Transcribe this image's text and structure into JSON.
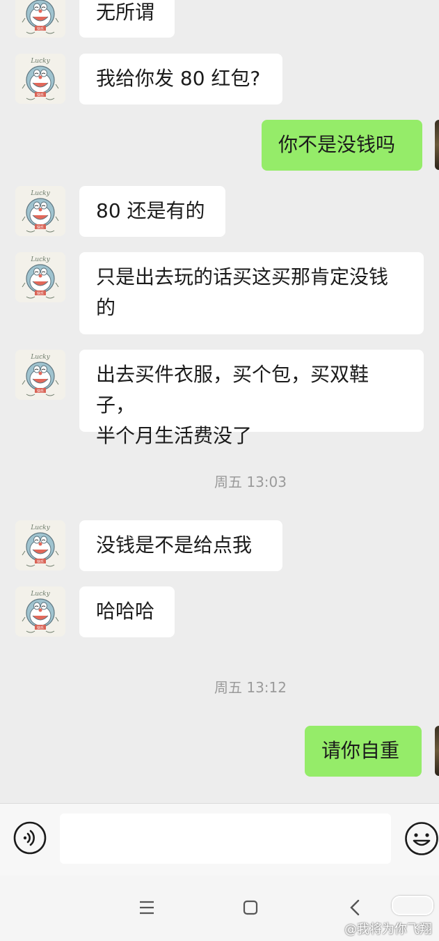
{
  "messages": [
    {
      "side": "left",
      "text": "无所谓"
    },
    {
      "side": "left",
      "text": "我给你发 80 红包?"
    },
    {
      "side": "right",
      "text": "你不是没钱吗"
    },
    {
      "side": "left",
      "text": "80 还是有的"
    },
    {
      "side": "left",
      "text": "只是出去玩的话买这买那肯定没钱\n的"
    },
    {
      "side": "left",
      "text": "出去买件衣服，买个包，买双鞋子，\n半个月生活费没了"
    },
    {
      "timestamp": "周五 13:03"
    },
    {
      "side": "left",
      "text": "没钱是不是给点我"
    },
    {
      "side": "left",
      "text": "哈哈哈"
    },
    {
      "timestamp": "周五 13:12"
    },
    {
      "side": "right",
      "text": "请你自重"
    }
  ],
  "avatar": {
    "badge_text": "Lucky"
  },
  "input_bar": {
    "voice_icon": "voice-icon",
    "emoji_icon": "emoji-icon",
    "value": ""
  },
  "nav_bar": {
    "icons": [
      "menu-icon",
      "home-icon",
      "back-icon"
    ]
  },
  "watermark": {
    "text": "@我将为你飞翔"
  },
  "colors": {
    "background": "#ededed",
    "bubble_left": "#ffffff",
    "bubble_right": "#95ec69",
    "timestamp": "#9a9a9a"
  }
}
